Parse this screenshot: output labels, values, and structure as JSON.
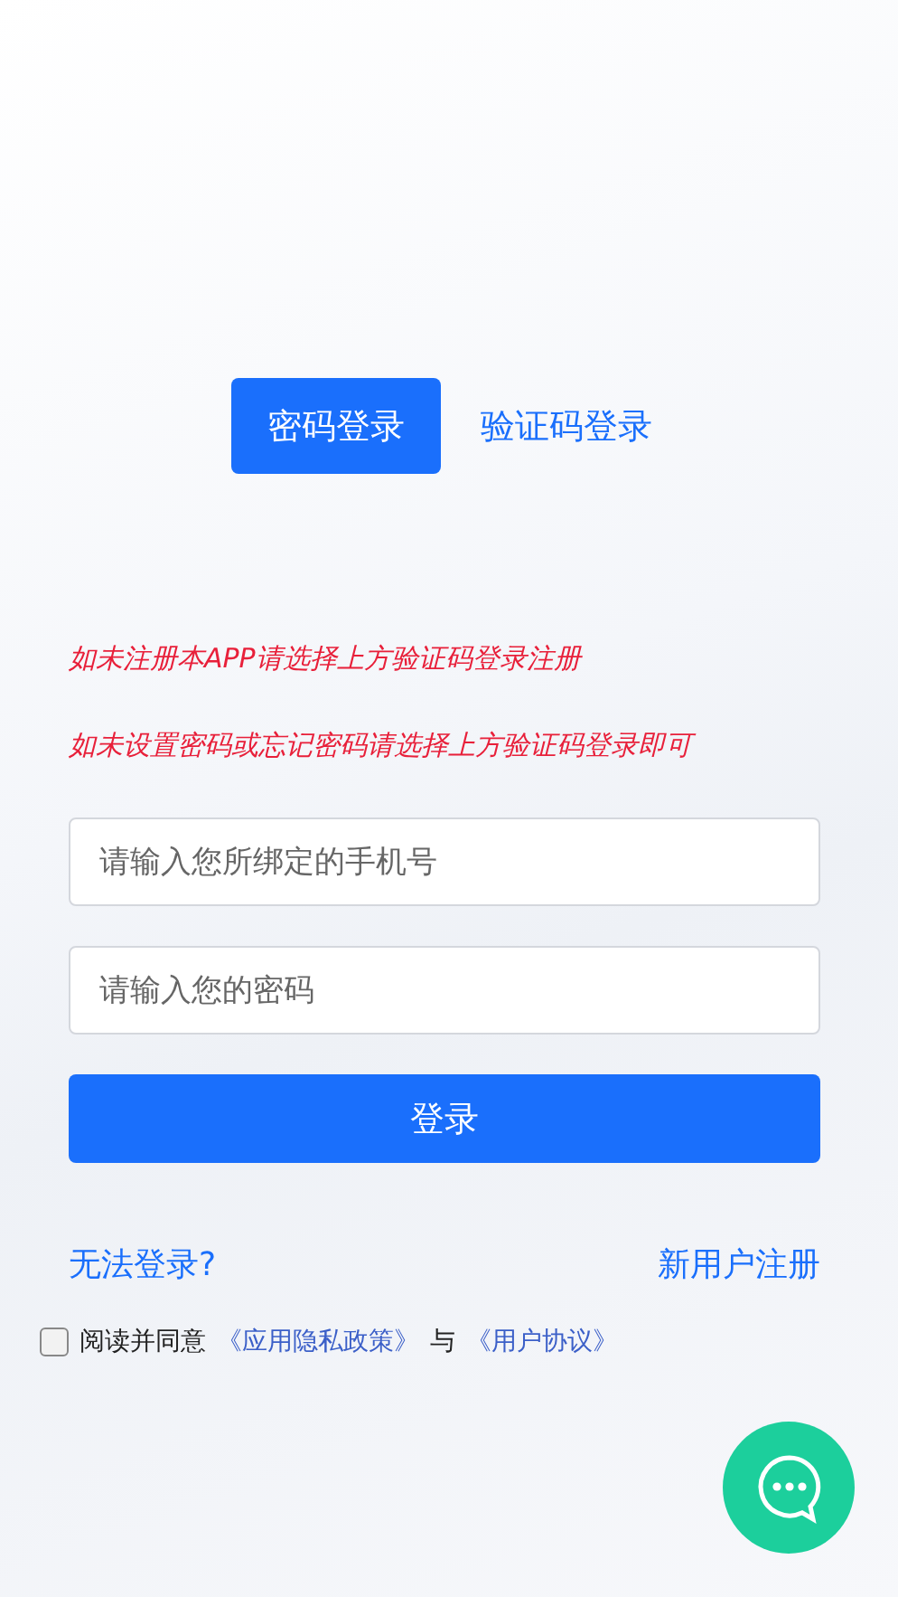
{
  "tabs": [
    {
      "label": "密码登录",
      "selected": true
    },
    {
      "label": "验证码登录",
      "selected": false
    }
  ],
  "notices": [
    "如未注册本APP请选择上方验证码登录注册",
    "如未设置密码或忘记密码请选择上方验证码登录即可"
  ],
  "fields": [
    {
      "placeholder": "请输入您所绑定的手机号"
    },
    {
      "placeholder": "请输入您的密码"
    }
  ],
  "login_button": "登录",
  "links": {
    "cannot_login": "无法登录?",
    "register": "新用户注册"
  },
  "agreement": {
    "checked": false,
    "text": "阅读并同意",
    "privacy_link": "《应用隐私政策》",
    "joiner": "与",
    "terms_link": "《用户协议》"
  }
}
